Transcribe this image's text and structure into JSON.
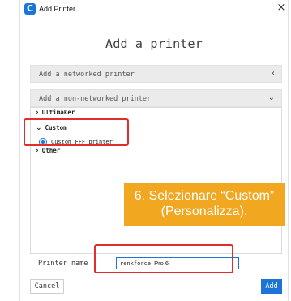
{
  "window": {
    "title": "Add Printer",
    "app_icon_letter": "C",
    "close_glyph": "×"
  },
  "heading": "Add a printer",
  "sections": {
    "networked": {
      "label": "Add a networked printer",
      "chevron": "‹"
    },
    "non_networked": {
      "label": "Add a non-networked printer",
      "chevron": "⌄"
    }
  },
  "tree": {
    "ultimaker": {
      "label": "Ultimaker",
      "state": "collapsed"
    },
    "custom": {
      "label": "Custom",
      "state": "expanded"
    },
    "custom_fff": {
      "label": "Custom FFF printer",
      "selected": true
    },
    "other": {
      "label": "Other",
      "state": "collapsed"
    }
  },
  "callout": {
    "line1": "6. Selezionare “Custom”",
    "line2": "(Personalizza)."
  },
  "printer_name": {
    "label": "Printer name",
    "value_prefix": "renkforce",
    "value_suffix": "Pro 6"
  },
  "buttons": {
    "cancel": "Cancel",
    "add": "Add"
  },
  "colors": {
    "accent": "#1c74d6",
    "highlight": "#e02d2d",
    "callout": "#f2a720"
  }
}
